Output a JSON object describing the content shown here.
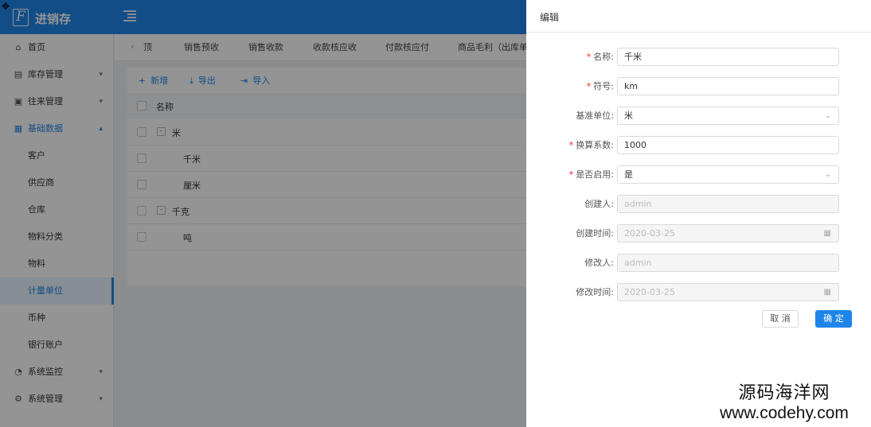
{
  "app": {
    "title": "进销存",
    "logo_letter": "F"
  },
  "sidebar": {
    "items": [
      {
        "label": "首页",
        "icon": "home-icon"
      },
      {
        "label": "库存管理",
        "icon": "inventory-icon"
      },
      {
        "label": "往来管理",
        "icon": "contacts-icon"
      },
      {
        "label": "基础数据",
        "icon": "grid-icon"
      },
      {
        "label": "客户"
      },
      {
        "label": "供应商"
      },
      {
        "label": "仓库"
      },
      {
        "label": "物料分类"
      },
      {
        "label": "物料"
      },
      {
        "label": "计量单位"
      },
      {
        "label": "币种"
      },
      {
        "label": "银行账户"
      },
      {
        "label": "系统监控",
        "icon": "monitor-icon"
      },
      {
        "label": "系统管理",
        "icon": "settings-icon"
      }
    ]
  },
  "tabs": [
    "顶",
    "销售预收",
    "销售收款",
    "收款核应收",
    "付款核应付",
    "商品毛利（出库单）"
  ],
  "toolbar": {
    "add": "新增",
    "export": "导出",
    "import": "导入"
  },
  "table": {
    "header": "名称",
    "rows": [
      "米",
      "千米",
      "厘米",
      "千克",
      "吨"
    ]
  },
  "drawer": {
    "title": "编辑",
    "fields": {
      "name": {
        "label": "名称:",
        "value": "千米"
      },
      "symbol": {
        "label": "符号:",
        "value": "km"
      },
      "base_unit": {
        "label": "基准单位:",
        "value": "米"
      },
      "factor": {
        "label": "换算系数:",
        "value": "1000"
      },
      "enabled": {
        "label": "是否启用:",
        "value": "是"
      },
      "creator": {
        "label": "创建人:",
        "value": "admin"
      },
      "created_at": {
        "label": "创建时间:",
        "value": "2020-03-25"
      },
      "modifier": {
        "label": "修改人:",
        "value": "admin"
      },
      "modified_at": {
        "label": "修改时间:",
        "value": "2020-03-25"
      }
    },
    "cancel": "取 消",
    "confirm": "确 定"
  },
  "watermark": {
    "cn": "源码海洋网",
    "url": "www.codehy.com"
  },
  "colors": {
    "primary": "#1f86e8",
    "required": "#f5222d"
  }
}
